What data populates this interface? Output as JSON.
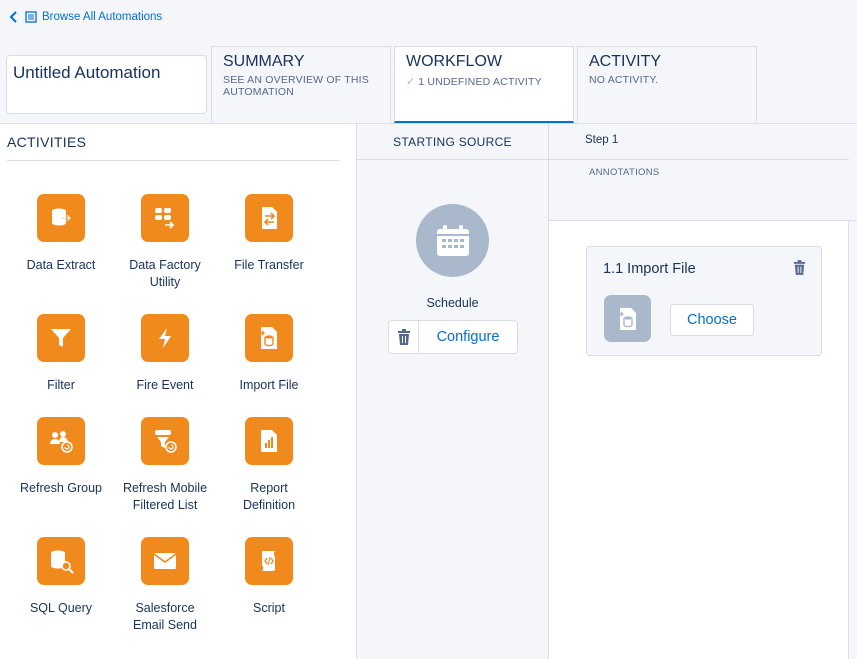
{
  "nav": {
    "back_label": "Browse All Automations"
  },
  "automation": {
    "name": "Untitled Automation"
  },
  "tabs": [
    {
      "title": "SUMMARY",
      "subtitle": "SEE AN OVERVIEW OF THIS AUTOMATION"
    },
    {
      "title": "WORKFLOW",
      "subtitle": "1 UNDEFINED ACTIVITY"
    },
    {
      "title": "ACTIVITY",
      "subtitle": "NO ACTIVITY."
    }
  ],
  "activities": {
    "heading": "ACTIVITIES",
    "items": [
      {
        "label": "Data Extract",
        "icon": "data-extract-icon"
      },
      {
        "label": "Data Factory\nUtility",
        "icon": "data-factory-utility-icon"
      },
      {
        "label": "File Transfer",
        "icon": "file-transfer-icon"
      },
      {
        "label": "Filter",
        "icon": "filter-icon"
      },
      {
        "label": "Fire Event",
        "icon": "fire-event-icon"
      },
      {
        "label": "Import File",
        "icon": "import-file-icon"
      },
      {
        "label": "Refresh Group",
        "icon": "refresh-group-icon"
      },
      {
        "label": "Refresh Mobile\nFiltered List",
        "icon": "refresh-mobile-filtered-list-icon"
      },
      {
        "label": "Report\nDefinition",
        "icon": "report-definition-icon"
      },
      {
        "label": "SQL Query",
        "icon": "sql-query-icon"
      },
      {
        "label": "Salesforce\nEmail Send",
        "icon": "email-send-icon"
      },
      {
        "label": "Script",
        "icon": "script-icon"
      }
    ]
  },
  "starting_source": {
    "heading": "STARTING SOURCE",
    "type_label": "Schedule",
    "configure_label": "Configure"
  },
  "step": {
    "heading": "Step 1",
    "annotations_label": "ANNOTATIONS",
    "card": {
      "title": "1.1 Import File",
      "choose_label": "Choose"
    }
  },
  "colors": {
    "accent": "#0070d2",
    "activity_tile": "#f08a1c",
    "placeholder_icon": "#a9b8cb",
    "text": "#16325c"
  }
}
